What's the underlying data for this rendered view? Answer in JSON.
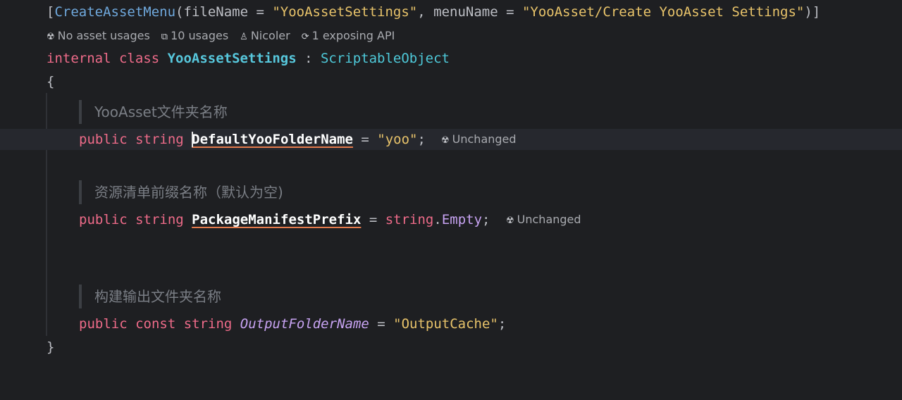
{
  "attribute_line": {
    "open": "[",
    "name": "CreateAssetMenu",
    "paren_open": "(",
    "arg1_name": "fileName",
    "eq": " = ",
    "arg1_value": "\"YooAssetSettings\"",
    "comma": ", ",
    "arg2_name": "menuName",
    "arg2_value": "\"YooAsset/Create YooAsset Settings\"",
    "close": ")]"
  },
  "code_vision": {
    "asset_usages": "No asset usages",
    "usages": "10 usages",
    "author": "Nicoler",
    "exposing_api": "1 exposing API"
  },
  "class_decl": {
    "modifiers": "internal class",
    "name": "YooAssetSettings",
    "colon": " : ",
    "base": "ScriptableObject"
  },
  "brace_open": "{",
  "brace_close": "}",
  "fields": [
    {
      "doc": "YooAsset文件夹名称",
      "modifiers": "public string",
      "name": "DefaultYooFolderName",
      "eq": " = ",
      "value": "\"yoo\"",
      "semi": ";",
      "hint": "Unchanged"
    },
    {
      "doc": "资源清单前缀名称（默认为空)",
      "modifiers": "public string",
      "name": "PackageManifestPrefix",
      "eq": " = ",
      "value_type": "string",
      "dot": ".",
      "value_member": "Empty",
      "semi": ";",
      "hint": "Unchanged"
    },
    {
      "doc": "构建输出文件夹名称",
      "modifiers": "public const string",
      "name": "OutputFolderName",
      "eq": " = ",
      "value": "\"OutputCache\"",
      "semi": ";"
    }
  ],
  "icons": {
    "unity_icon": "☢",
    "usages_icon": "⧉",
    "author_icon": "♙",
    "api_icon": "⟳"
  },
  "colors": {
    "background": "#1e1f22",
    "keyword": "#ee6b89",
    "string": "#e8c36a",
    "type": "#4ec9d9",
    "constant": "#c7a3f2"
  }
}
